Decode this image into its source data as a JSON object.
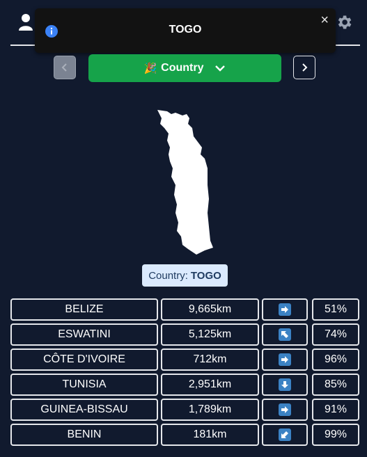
{
  "header": {
    "user_icon": "user-icon",
    "settings_icon": "gear-icon"
  },
  "toast": {
    "title": "TOGO",
    "close_label": "×",
    "icon": "info-icon"
  },
  "toolbar": {
    "prev_icon": "chevron-left-icon",
    "next_icon": "chevron-right-icon",
    "mode_emoji": "🎉",
    "mode_label": "Country",
    "mode_icon": "chevron-down-icon"
  },
  "answer": {
    "prefix": "Country:",
    "name": "TOGO"
  },
  "guesses": [
    {
      "country": "BELIZE",
      "distance": "9,665km",
      "direction": "east-arrow-icon",
      "proximity": "51%"
    },
    {
      "country": "ESWATINI",
      "distance": "5,125km",
      "direction": "northwest-arrow-icon",
      "proximity": "74%"
    },
    {
      "country": "CÔTE D'IVOIRE",
      "distance": "712km",
      "direction": "east-arrow-icon",
      "proximity": "96%"
    },
    {
      "country": "TUNISIA",
      "distance": "2,951km",
      "direction": "south-arrow-icon",
      "proximity": "85%"
    },
    {
      "country": "GUINEA-BISSAU",
      "distance": "1,789km",
      "direction": "east-arrow-icon",
      "proximity": "91%"
    },
    {
      "country": "BENIN",
      "distance": "181km",
      "direction": "southwest-arrow-icon",
      "proximity": "99%"
    }
  ],
  "colors": {
    "background": "#111a2e",
    "accent_green": "#16a34a",
    "label_bg": "#dbeafe",
    "arrow_bg": "#3b82c4"
  }
}
